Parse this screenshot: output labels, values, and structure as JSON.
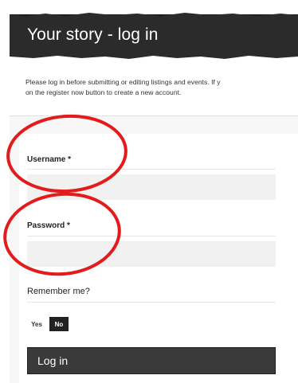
{
  "header": {
    "title": "Your story - log in"
  },
  "intro": {
    "line1": "Please log in before submitting or editing listings and events. If y",
    "line2": "on the register now button to create a new account."
  },
  "form": {
    "username": {
      "label": "Username *",
      "value": "",
      "placeholder": ""
    },
    "password": {
      "label": "Password *",
      "value": "",
      "placeholder": ""
    },
    "remember": {
      "label": "Remember me?",
      "options": [
        "Yes",
        "No"
      ],
      "selected": "No"
    },
    "submit_label": "Log in"
  },
  "colors": {
    "header_bg": "#2b2b2b",
    "annotation_circle": "#e31b1b",
    "button_bg": "#3a3a3a",
    "input_bg": "#f1f1f1"
  }
}
